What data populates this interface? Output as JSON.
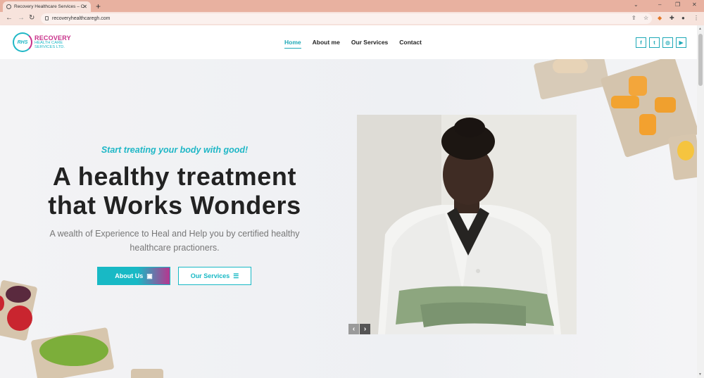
{
  "browser": {
    "tab_title": "Recovery Healthcare Services – C",
    "url": "recoveryhealthcaregh.com"
  },
  "header": {
    "logo_mark": "RHS",
    "logo_line1": "RECOVERY",
    "logo_line2": "HEALTH CARE",
    "logo_line3": "SERVICES LTD.",
    "nav": [
      {
        "label": "Home",
        "active": true
      },
      {
        "label": "About me"
      },
      {
        "label": "Our Services"
      },
      {
        "label": "Contact"
      }
    ],
    "social": [
      {
        "icon": "facebook-icon",
        "glyph": "f"
      },
      {
        "icon": "twitter-icon",
        "glyph": "t"
      },
      {
        "icon": "instagram-icon",
        "glyph": "◎"
      },
      {
        "icon": "youtube-icon",
        "glyph": "▶"
      }
    ]
  },
  "hero": {
    "tagline": "Start treating your body with good!",
    "headline_line1": "A healthy treatment",
    "headline_line2": "that Works Wonders",
    "subtext": "A wealth of Experience to Heal and Help you by certified healthy healthcare practioners.",
    "about_button": "About Us",
    "services_button": "Our Services"
  },
  "colors": {
    "accent": "#1fb7c6",
    "brand_magenta": "#c8308a"
  }
}
